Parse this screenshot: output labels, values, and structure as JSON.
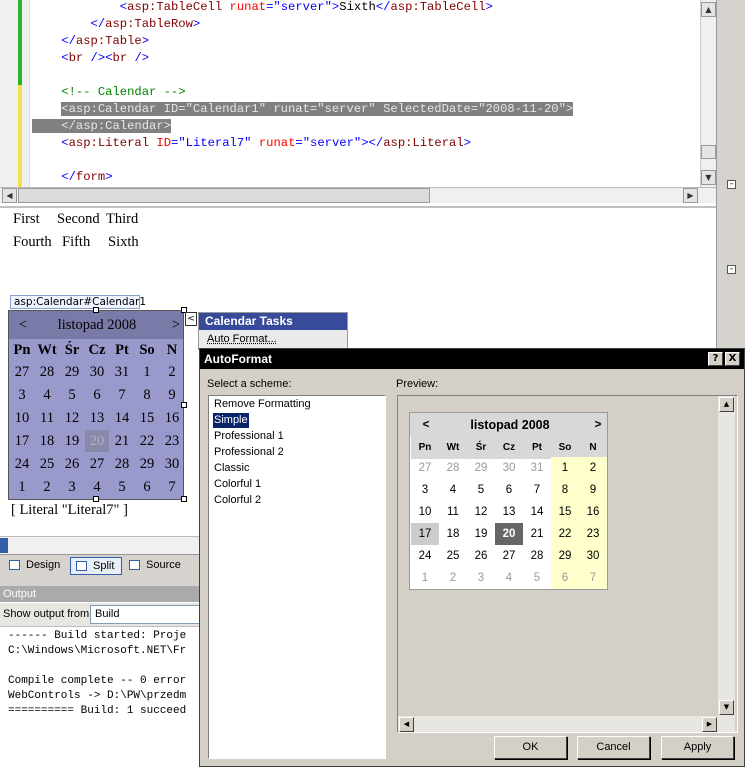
{
  "code": {
    "lines": [
      {
        "parts": [
          {
            "t": "            ",
            "c": ""
          },
          {
            "t": "<",
            "c": "b"
          },
          {
            "t": "asp:TableCell",
            "c": "m"
          },
          {
            "t": " ",
            "c": ""
          },
          {
            "t": "runat",
            "c": "r"
          },
          {
            "t": "=",
            "c": "b"
          },
          {
            "t": "\"server\"",
            "c": "b"
          },
          {
            "t": ">",
            "c": "b"
          },
          {
            "t": "Sixth",
            "c": ""
          },
          {
            "t": "</",
            "c": "b"
          },
          {
            "t": "asp:TableCell",
            "c": "m"
          },
          {
            "t": ">",
            "c": "b"
          }
        ]
      },
      {
        "parts": [
          {
            "t": "        ",
            "c": ""
          },
          {
            "t": "</",
            "c": "b"
          },
          {
            "t": "asp:TableRow",
            "c": "m"
          },
          {
            "t": ">",
            "c": "b"
          }
        ]
      },
      {
        "parts": [
          {
            "t": "    ",
            "c": ""
          },
          {
            "t": "</",
            "c": "b"
          },
          {
            "t": "asp:Table",
            "c": "m"
          },
          {
            "t": ">",
            "c": "b"
          }
        ]
      },
      {
        "parts": [
          {
            "t": "    ",
            "c": ""
          },
          {
            "t": "<",
            "c": "b"
          },
          {
            "t": "br",
            "c": "m"
          },
          {
            "t": " />",
            "c": "b"
          },
          {
            "t": "<",
            "c": "b"
          },
          {
            "t": "br",
            "c": "m"
          },
          {
            "t": " />",
            "c": "b"
          }
        ]
      },
      {
        "parts": [
          {
            "t": "",
            "c": ""
          }
        ]
      },
      {
        "parts": [
          {
            "t": "    ",
            "c": ""
          },
          {
            "t": "<!-- Calendar -->",
            "c": "g"
          }
        ]
      },
      {
        "parts": [
          {
            "t": "    ",
            "c": ""
          },
          {
            "t": "<asp:Calendar ID=\"Calendar1\" runat=\"server\" SelectedDate=\"2008-11-20\">",
            "c": "sel"
          }
        ]
      },
      {
        "parts": [
          {
            "t": "    </asp:Calendar>",
            "c": "sel"
          }
        ]
      },
      {
        "parts": [
          {
            "t": "    ",
            "c": ""
          },
          {
            "t": "<",
            "c": "b"
          },
          {
            "t": "asp:Literal",
            "c": "m"
          },
          {
            "t": " ",
            "c": ""
          },
          {
            "t": "ID",
            "c": "r"
          },
          {
            "t": "=",
            "c": "b"
          },
          {
            "t": "\"Literal7\"",
            "c": "b"
          },
          {
            "t": " ",
            "c": ""
          },
          {
            "t": "runat",
            "c": "r"
          },
          {
            "t": "=",
            "c": "b"
          },
          {
            "t": "\"server\"",
            "c": "b"
          },
          {
            "t": "></",
            "c": "b"
          },
          {
            "t": "asp:Literal",
            "c": "m"
          },
          {
            "t": ">",
            "c": "b"
          }
        ]
      },
      {
        "parts": [
          {
            "t": "",
            "c": ""
          }
        ]
      },
      {
        "parts": [
          {
            "t": "    ",
            "c": ""
          },
          {
            "t": "</",
            "c": "b"
          },
          {
            "t": "form",
            "c": "m"
          },
          {
            "t": ">",
            "c": "b"
          }
        ]
      }
    ]
  },
  "design": {
    "table_row1": [
      "First",
      "Second",
      "Third"
    ],
    "table_row2": [
      "Fourth",
      "Fifth",
      "Sixth"
    ],
    "calendar_tag": "asp:Calendar#Calendar1",
    "calendar_prev": "<",
    "calendar_next": ">",
    "calendar_title": "listopad 2008",
    "weekdays": [
      "Pn",
      "Wt",
      "Śr",
      "Cz",
      "Pt",
      "So",
      "N"
    ],
    "weeks": [
      [
        "27",
        "28",
        "29",
        "30",
        "31",
        "1",
        "2"
      ],
      [
        "3",
        "4",
        "5",
        "6",
        "7",
        "8",
        "9"
      ],
      [
        "10",
        "11",
        "12",
        "13",
        "14",
        "15",
        "16"
      ],
      [
        "17",
        "18",
        "19",
        "20",
        "21",
        "22",
        "23"
      ],
      [
        "24",
        "25",
        "26",
        "27",
        "28",
        "29",
        "30"
      ],
      [
        "1",
        "2",
        "3",
        "4",
        "5",
        "6",
        "7"
      ]
    ],
    "selected_day": "20",
    "literal": "[ Literal \"Literal7\" ]",
    "tasks_title": "Calendar Tasks",
    "tasks_item": "Auto Format..."
  },
  "views": {
    "design": "Design",
    "split": "Split",
    "source": "Source"
  },
  "output": {
    "title": "Output",
    "show_from_label": "Show output from:",
    "show_from_value": "Build",
    "lines": [
      "------ Build started: Proje",
      "C:\\Windows\\Microsoft.NET\\Fr",
      "",
      "Compile complete -- 0 error",
      "WebControls -> D:\\PW\\przedm",
      "========== Build: 1 succeed"
    ]
  },
  "dialog": {
    "title": "AutoFormat",
    "help": "?",
    "close": "X",
    "scheme_label": "Select a scheme:",
    "preview_label": "Preview:",
    "schemes": [
      "Remove Formatting",
      "Simple",
      "Professional 1",
      "Professional 2",
      "Classic",
      "Colorful 1",
      "Colorful 2"
    ],
    "selected_scheme": "Simple",
    "preview": {
      "title": "listopad 2008",
      "prev": "<",
      "next": ">",
      "weekdays": [
        "Pn",
        "Wt",
        "Śr",
        "Cz",
        "Pt",
        "So",
        "N"
      ],
      "selected_day": "20"
    },
    "ok": "OK",
    "cancel": "Cancel",
    "apply": "Apply"
  }
}
